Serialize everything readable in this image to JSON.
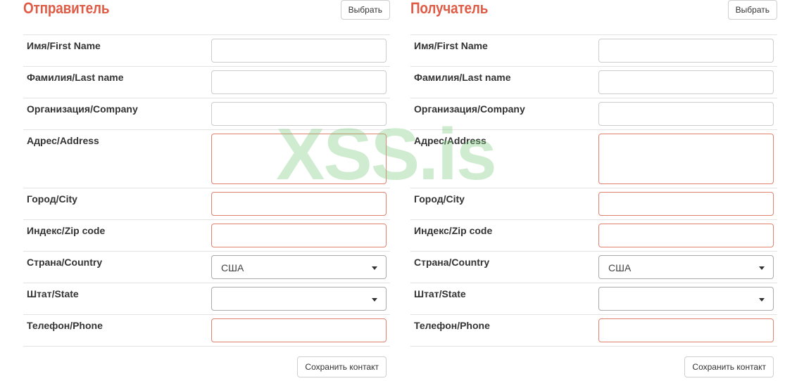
{
  "colors": {
    "accent": "#e05b45",
    "invalid_border": "#e0826e",
    "watermark": "#78c878"
  },
  "watermark": {
    "text": "XSS.is"
  },
  "sender": {
    "title": "Отправитель",
    "choose_label": "Выбрать",
    "save_label": "Сохранить контакт",
    "fields": {
      "first_name": "Имя/First Name",
      "last_name": "Фамилия/Last name",
      "company": "Организация/Company",
      "address": "Адрес/Address",
      "city": "Город/City",
      "zip": "Индекс/Zip code",
      "country": "Страна/Country",
      "state": "Штат/State",
      "phone": "Телефон/Phone"
    },
    "country_value": "США",
    "state_value": ""
  },
  "recipient": {
    "title": "Получатель",
    "choose_label": "Выбрать",
    "save_label": "Сохранить контакт",
    "fields": {
      "first_name": "Имя/First Name",
      "last_name": "Фамилия/Last name",
      "company": "Организация/Company",
      "address": "Адрес/Address",
      "city": "Город/City",
      "zip": "Индекс/Zip code",
      "country": "Страна/Country",
      "state": "Штат/State",
      "phone": "Телефон/Phone"
    },
    "country_value": "США",
    "state_value": ""
  }
}
